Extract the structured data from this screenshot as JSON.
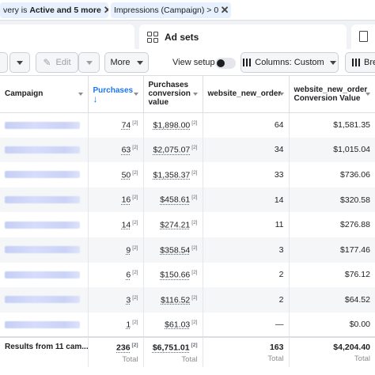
{
  "filters": {
    "chip1": {
      "prefix": "very is",
      "bold": "Active and 5 more"
    },
    "chip2": {
      "text": "Impressions (Campaign) > 0"
    }
  },
  "tabs": {
    "adsets_label": "Ad sets"
  },
  "toolbar": {
    "edit_label": "Edit",
    "more_label": "More",
    "view_setup_label": "View setup",
    "columns_label": "Columns: Custom",
    "breakdown_label": "Bre"
  },
  "table": {
    "headers": {
      "campaign": "Campaign",
      "purchases": "Purchases",
      "purchases_value": "Purchases conversion value",
      "website_new_order": "website_new_order",
      "website_new_order_value": "website_new_order Conversion Value"
    },
    "footnote": "[2]",
    "rows": [
      {
        "purchases": "74",
        "value": "$1,898.00",
        "orders": "64",
        "order_value": "$1,581.35"
      },
      {
        "purchases": "63",
        "value": "$2,075.07",
        "orders": "34",
        "order_value": "$1,015.04"
      },
      {
        "purchases": "50",
        "value": "$1,358.37",
        "orders": "33",
        "order_value": "$736.06"
      },
      {
        "purchases": "16",
        "value": "$458.61",
        "orders": "14",
        "order_value": "$320.58"
      },
      {
        "purchases": "14",
        "value": "$274.21",
        "orders": "11",
        "order_value": "$276.88"
      },
      {
        "purchases": "9",
        "value": "$358.54",
        "orders": "3",
        "order_value": "$177.46"
      },
      {
        "purchases": "6",
        "value": "$150.66",
        "orders": "2",
        "order_value": "$76.12"
      },
      {
        "purchases": "3",
        "value": "$116.52",
        "orders": "2",
        "order_value": "$64.52"
      },
      {
        "purchases": "1",
        "value": "$61.03",
        "orders": "—",
        "order_value": "$0.00"
      }
    ],
    "totals": {
      "label": "Results from 11 cam...",
      "purchases": "236",
      "value": "$6,751.01",
      "orders": "163",
      "order_value": "$4,204.40",
      "sub": "Total"
    }
  }
}
